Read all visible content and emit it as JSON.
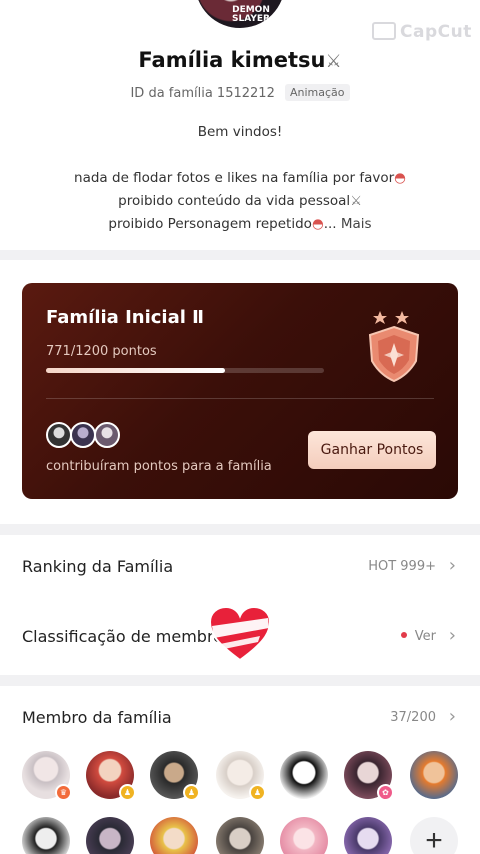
{
  "watermark": "CapCut",
  "avatar_logo": "DEMON SLAYER",
  "family": {
    "name": "Família kimetsu",
    "name_icon": "crossed-swords-icon",
    "id_text": "ID da família 1512212",
    "category": "Animação",
    "welcome": "Bem vindos!",
    "rule1": "nada de flodar fotos e likes na família por favor",
    "rule2": "proibido conteúdo da vida pessoal",
    "rule3": "proibido Personagem repetido",
    "ellipsis": "...",
    "more": "Mais"
  },
  "card": {
    "title": "Família Inicial Ⅱ",
    "points_text": "771/1200 pontos",
    "progress": 0.6425,
    "contrib_text": "contribuíram pontos para a família",
    "earn_button": "Ganhar Pontos",
    "colors": {
      "bg_start": "#5a1a10",
      "bg_end": "#2a0905",
      "button": "#f4cdbc"
    }
  },
  "ranking": {
    "label": "Ranking da Família",
    "value": "HOT 999+"
  },
  "classification": {
    "label": "Classificação de membro",
    "value": "Ver",
    "dot_color": "#e23b4a"
  },
  "members": {
    "title": "Membro da família",
    "count": "37/200",
    "add_label": "+"
  }
}
